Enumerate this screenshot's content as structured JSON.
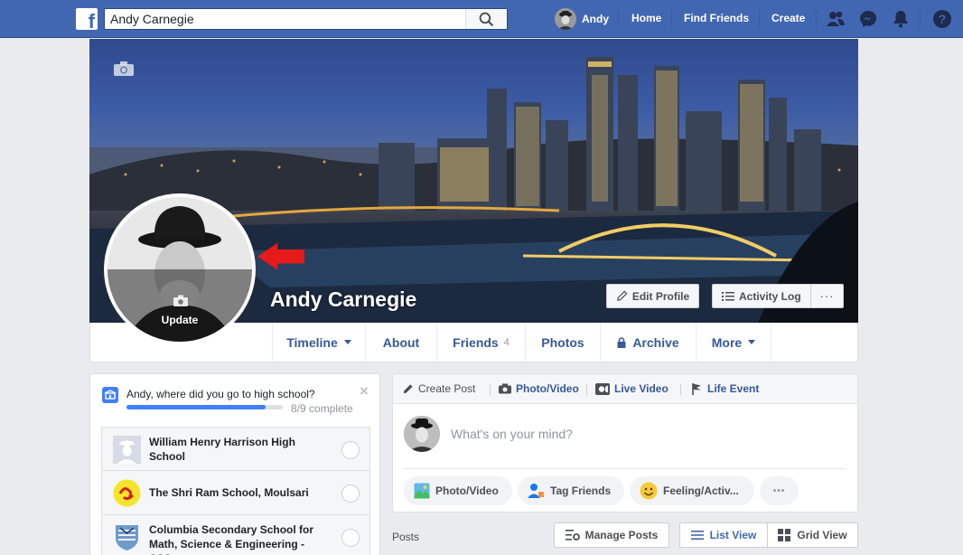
{
  "topbar": {
    "search_value": "Andy Carnegie",
    "search_placeholder": "Search",
    "user_name": "Andy",
    "links": {
      "home": "Home",
      "find_friends": "Find Friends",
      "create": "Create"
    }
  },
  "profile": {
    "name": "Andy Carnegie",
    "update_label": "Update",
    "edit_profile": "Edit Profile",
    "activity_log": "Activity Log",
    "more_dots": "···"
  },
  "tabs": [
    {
      "label": "Timeline"
    },
    {
      "label": "About"
    },
    {
      "label": "Friends",
      "count": "4"
    },
    {
      "label": "Photos"
    },
    {
      "label": "Archive"
    },
    {
      "label": "More"
    }
  ],
  "school_card": {
    "question": "Andy, where did you go to high school?",
    "progress": 0.889,
    "progress_label": "8/9 complete",
    "close": "×",
    "schools": [
      {
        "name": "William Henry Harrison High School"
      },
      {
        "name": "The Shri Ram School, Moulsari"
      },
      {
        "name": "Columbia Secondary School for Math, Science & Engineering - CSS"
      }
    ]
  },
  "composer": {
    "tabs": {
      "create_post": "Create Post",
      "photo_video": "Photo/Video",
      "live_video": "Live Video",
      "life_event": "Life Event"
    },
    "placeholder": "What's on your mind?",
    "chips": {
      "photo_video": "Photo/Video",
      "tag_friends": "Tag Friends",
      "feeling": "Feeling/Activ...",
      "more": "•••"
    }
  },
  "posts": {
    "label": "Posts",
    "manage": "Manage Posts",
    "list_view": "List View",
    "grid_view": "Grid View"
  },
  "colors": {
    "brand": "#4267b2",
    "link": "#365899",
    "accent": "#4080ff",
    "arrow": "#e51a1a"
  }
}
